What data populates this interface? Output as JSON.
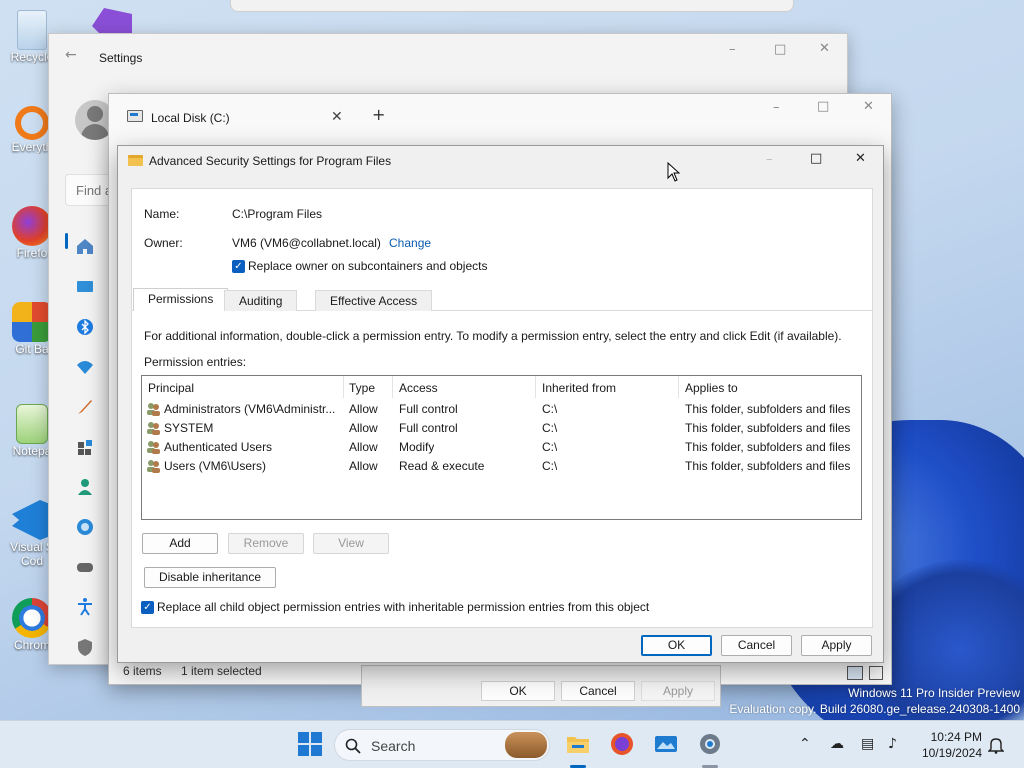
{
  "desktop": {
    "icons": [
      {
        "label": "Recycle"
      },
      {
        "label": "Everyth"
      },
      {
        "label": "Firefo"
      },
      {
        "label": "Git Ba"
      },
      {
        "label": "Notepa"
      },
      {
        "label": "Visual S Cod"
      },
      {
        "label": "Chrom"
      }
    ],
    "watermark": {
      "line1": "Windows 11 Pro Insider Preview",
      "line2": "Evaluation copy. Build 26080.ge_release.240308-1400"
    }
  },
  "settings_window": {
    "title": "Settings",
    "search_placeholder": "Find a"
  },
  "explorer_window": {
    "tab_title": "Local Disk (C:)",
    "new_tab": "+",
    "status_items": "6 items",
    "status_selected": "1 item selected"
  },
  "properties_dialog": {
    "ok": "OK",
    "cancel": "Cancel",
    "apply": "Apply"
  },
  "dialog": {
    "title": "Advanced Security Settings for Program Files",
    "name_label": "Name:",
    "name_value": "C:\\Program Files",
    "owner_label": "Owner:",
    "owner_value": "VM6 (VM6@collabnet.local)",
    "change_link": "Change",
    "replace_owner": "Replace owner on subcontainers and objects",
    "tabs": [
      "Permissions",
      "Auditing",
      "Effective Access"
    ],
    "info_text": "For additional information, double-click a permission entry. To modify a permission entry, select the entry and click Edit (if available).",
    "entries_label": "Permission entries:",
    "columns": [
      "Principal",
      "Type",
      "Access",
      "Inherited from",
      "Applies to"
    ],
    "rows": [
      {
        "principal": "Administrators (VM6\\Administr...",
        "type": "Allow",
        "access": "Full control",
        "inherited": "C:\\",
        "applies": "This folder, subfolders and files"
      },
      {
        "principal": "SYSTEM",
        "type": "Allow",
        "access": "Full control",
        "inherited": "C:\\",
        "applies": "This folder, subfolders and files"
      },
      {
        "principal": "Authenticated Users",
        "type": "Allow",
        "access": "Modify",
        "inherited": "C:\\",
        "applies": "This folder, subfolders and files"
      },
      {
        "principal": "Users (VM6\\Users)",
        "type": "Allow",
        "access": "Read & execute",
        "inherited": "C:\\",
        "applies": "This folder, subfolders and files"
      }
    ],
    "add": "Add",
    "remove": "Remove",
    "view": "View",
    "disable_inheritance": "Disable inheritance",
    "replace_child": "Replace all child object permission entries with inheritable permission entries from this object",
    "ok": "OK",
    "cancel": "Cancel",
    "apply": "Apply"
  },
  "taskbar": {
    "search": "Search",
    "time": "10:24 PM",
    "date": "10/19/2024"
  },
  "colors": {
    "accent": "#0067c0",
    "link": "#0b5cad",
    "checkbox": "#0a5fc0"
  }
}
